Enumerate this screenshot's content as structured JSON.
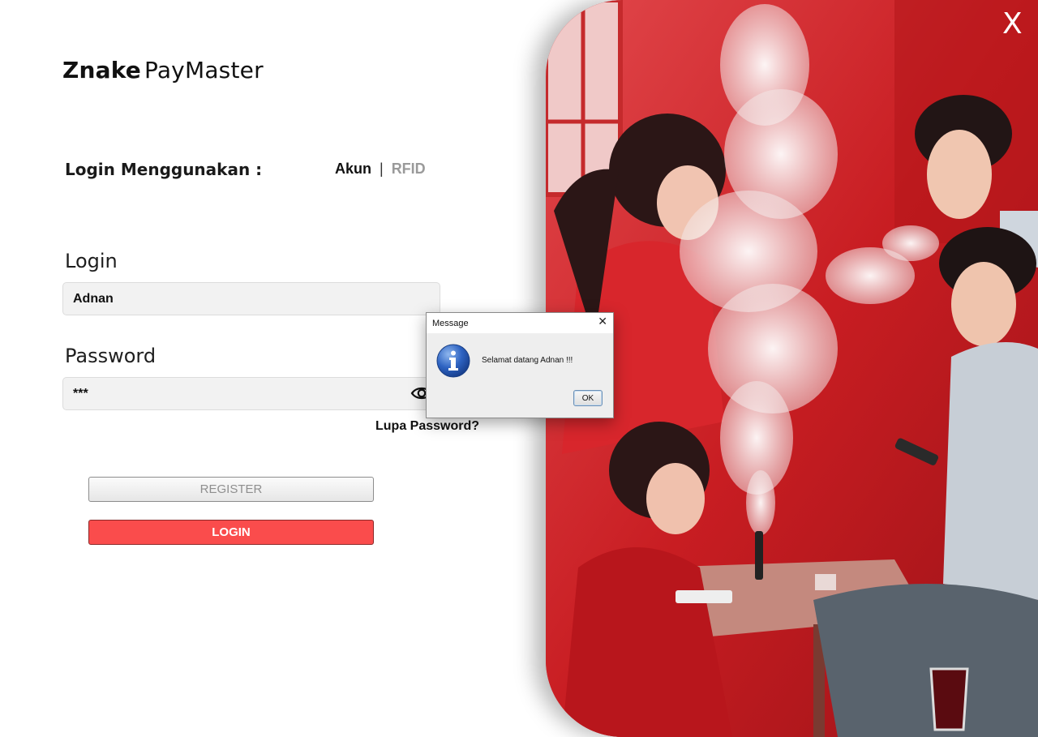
{
  "brand": {
    "bold": "Znake",
    "regular": "PayMaster"
  },
  "login_method": {
    "label": "Login Menggunakan :",
    "option_account": "Akun",
    "separator": "|",
    "option_rfid": "RFID"
  },
  "form": {
    "username_label": "Login",
    "username_value": "Adnan",
    "password_label": "Password",
    "password_value": "***",
    "forgot_password": "Lupa Password?"
  },
  "buttons": {
    "register": "REGISTER",
    "login": "LOGIN"
  },
  "window": {
    "close": "X"
  },
  "dialog": {
    "title": "Message",
    "close": "✕",
    "message": "Selamat datang Adnan !!!",
    "ok": "OK"
  },
  "colors": {
    "accent_red": "#fa4c4c",
    "hero_red": "#d01e24",
    "text_dark": "#111111",
    "muted_gray": "#9a9a9a"
  },
  "icons": [
    "eye-icon",
    "info-icon",
    "close-icon"
  ]
}
